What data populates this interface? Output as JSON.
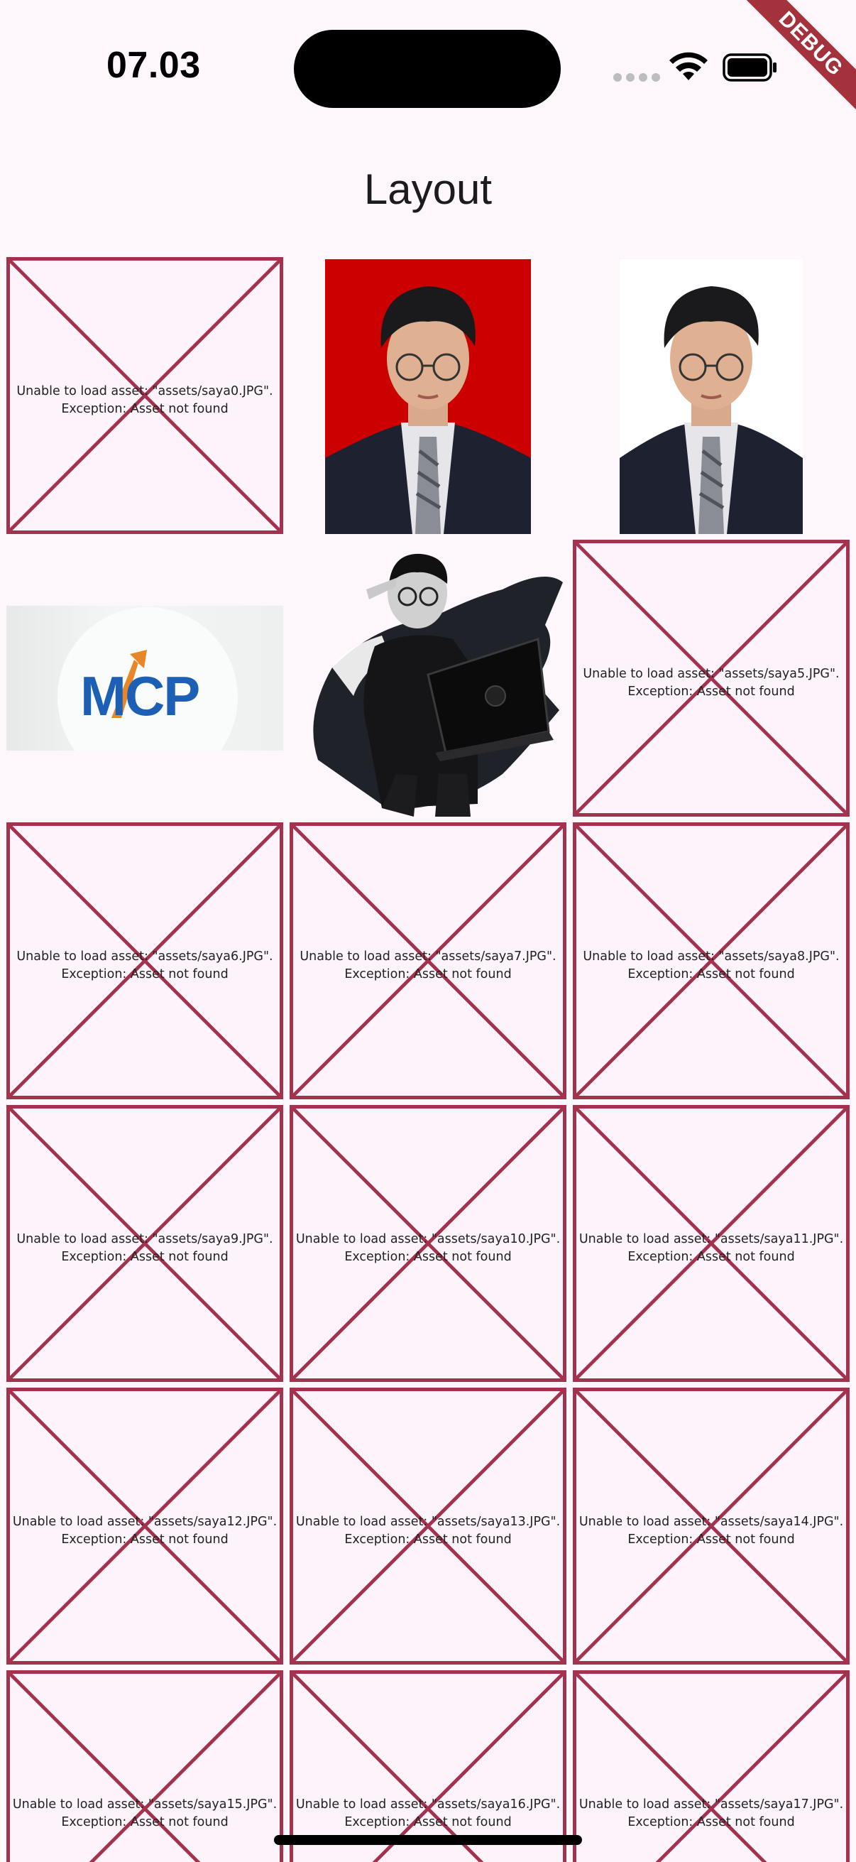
{
  "status_bar": {
    "time": "07.03"
  },
  "debug_banner": "DEBUG",
  "app_bar": {
    "title": "Layout"
  },
  "grid": {
    "items": [
      {
        "type": "error",
        "line1": "Unable to load asset: \"assets/saya0.JPG\".",
        "line2": "Exception: Asset not found"
      },
      {
        "type": "photo",
        "variant": "red-background-portrait",
        "background": "#cc0000"
      },
      {
        "type": "photo",
        "variant": "white-background-portrait",
        "background": "#ffffff"
      },
      {
        "type": "photo",
        "variant": "mcp-logo",
        "logo_text": "MCP"
      },
      {
        "type": "photo",
        "variant": "black-white-laptop-photo"
      },
      {
        "type": "error",
        "line1": "Unable to load asset: \"assets/saya5.JPG\".",
        "line2": "Exception: Asset not found"
      },
      {
        "type": "error",
        "line1": "Unable to load asset: \"assets/saya6.JPG\".",
        "line2": "Exception: Asset not found"
      },
      {
        "type": "error",
        "line1": "Unable to load asset: \"assets/saya7.JPG\".",
        "line2": "Exception: Asset not found"
      },
      {
        "type": "error",
        "line1": "Unable to load asset: \"assets/saya8.JPG\".",
        "line2": "Exception: Asset not found"
      },
      {
        "type": "error",
        "line1": "Unable to load asset: \"assets/saya9.JPG\".",
        "line2": "Exception: Asset not found"
      },
      {
        "type": "error",
        "line1": "Unable to load asset: \"assets/saya10.JPG\".",
        "line2": "Exception: Asset not found"
      },
      {
        "type": "error",
        "line1": "Unable to load asset: \"assets/saya11.JPG\".",
        "line2": "Exception: Asset not found"
      },
      {
        "type": "error",
        "line1": "Unable to load asset: \"assets/saya12.JPG\".",
        "line2": "Exception: Asset not found"
      },
      {
        "type": "error",
        "line1": "Unable to load asset: \"assets/saya13.JPG\".",
        "line2": "Exception: Asset not found"
      },
      {
        "type": "error",
        "line1": "Unable to load asset: \"assets/saya14.JPG\".",
        "line2": "Exception: Asset not found"
      },
      {
        "type": "error",
        "line1": "Unable to load asset: \"assets/saya15.JPG\".",
        "line2": "Exception: Asset not found"
      },
      {
        "type": "error",
        "line1": "Unable to load asset: \"assets/saya16.JPG\".",
        "line2": "Exception: Asset not found"
      },
      {
        "type": "error",
        "line1": "Unable to load asset: \"assets/saya17.JPG\".",
        "line2": "Exception: Asset not found"
      }
    ]
  },
  "colors": {
    "error_border": "#a3324e",
    "error_background": "#fdf4fb",
    "debug_banner": "#a3323c",
    "page_background": "#fdf7fc"
  }
}
